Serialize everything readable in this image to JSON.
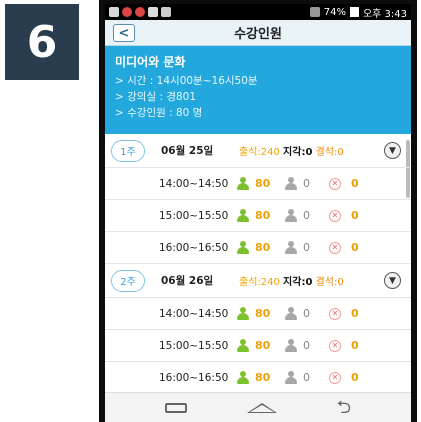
{
  "step": {
    "number": "6"
  },
  "statusbar": {
    "battery": "74%",
    "time": "오후 3:43"
  },
  "titlebar": {
    "back": "<",
    "title": "수강인원"
  },
  "info": {
    "course": "미디어와 문화",
    "time": "> 시간 : 14시00분~16시50분",
    "room": "> 강의실 : 경801",
    "count": "> 수강인원 : 80 명"
  },
  "weeks": [
    {
      "week": "1주",
      "date": "06월 25일",
      "attendance": "출석:240",
      "late": "지각:0",
      "absent": "결석:0",
      "slots": [
        {
          "time": "14:00~14:50",
          "present": "80",
          "late": "0",
          "absent": "0"
        },
        {
          "time": "15:00~15:50",
          "present": "80",
          "late": "0",
          "absent": "0"
        },
        {
          "time": "16:00~16:50",
          "present": "80",
          "late": "0",
          "absent": "0"
        }
      ]
    },
    {
      "week": "2주",
      "date": "06월 26일",
      "attendance": "출석:240",
      "late": "지각:0",
      "absent": "결석:0",
      "slots": [
        {
          "time": "14:00~14:50",
          "present": "80",
          "late": "0",
          "absent": "0"
        },
        {
          "time": "15:00~15:50",
          "present": "80",
          "late": "0",
          "absent": "0"
        },
        {
          "time": "16:00~16:50",
          "present": "80",
          "late": "0",
          "absent": "0"
        }
      ]
    }
  ],
  "colors": {
    "header_blue": "#22a8dc",
    "present_green": "#7cc22c",
    "value_orange": "#f0a000"
  }
}
